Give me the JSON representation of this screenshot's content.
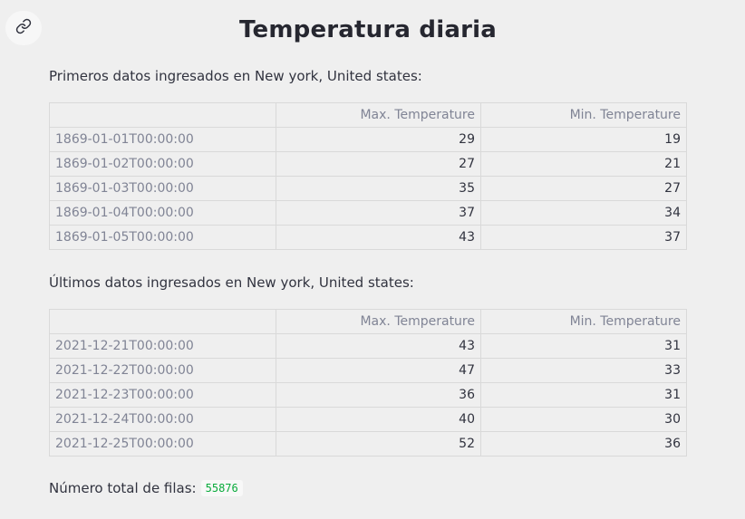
{
  "header": {
    "title": "Temperatura diaria"
  },
  "first": {
    "caption": "Primeros datos ingresados en New york, United states:",
    "columns": [
      "",
      "Max. Temperature",
      "Min. Temperature"
    ],
    "rows": [
      {
        "date": "1869-01-01T00:00:00",
        "max": "29",
        "min": "19"
      },
      {
        "date": "1869-01-02T00:00:00",
        "max": "27",
        "min": "21"
      },
      {
        "date": "1869-01-03T00:00:00",
        "max": "35",
        "min": "27"
      },
      {
        "date": "1869-01-04T00:00:00",
        "max": "37",
        "min": "34"
      },
      {
        "date": "1869-01-05T00:00:00",
        "max": "43",
        "min": "37"
      }
    ]
  },
  "last": {
    "caption": "Últimos datos ingresados en New york, United states:",
    "columns": [
      "",
      "Max. Temperature",
      "Min. Temperature"
    ],
    "rows": [
      {
        "date": "2021-12-21T00:00:00",
        "max": "43",
        "min": "31"
      },
      {
        "date": "2021-12-22T00:00:00",
        "max": "47",
        "min": "33"
      },
      {
        "date": "2021-12-23T00:00:00",
        "max": "36",
        "min": "31"
      },
      {
        "date": "2021-12-24T00:00:00",
        "max": "40",
        "min": "30"
      },
      {
        "date": "2021-12-25T00:00:00",
        "max": "52",
        "min": "36"
      }
    ]
  },
  "footer": {
    "total_label": "Número total de filas:",
    "total_value": "55876"
  },
  "icons": {
    "link": "link-icon"
  }
}
